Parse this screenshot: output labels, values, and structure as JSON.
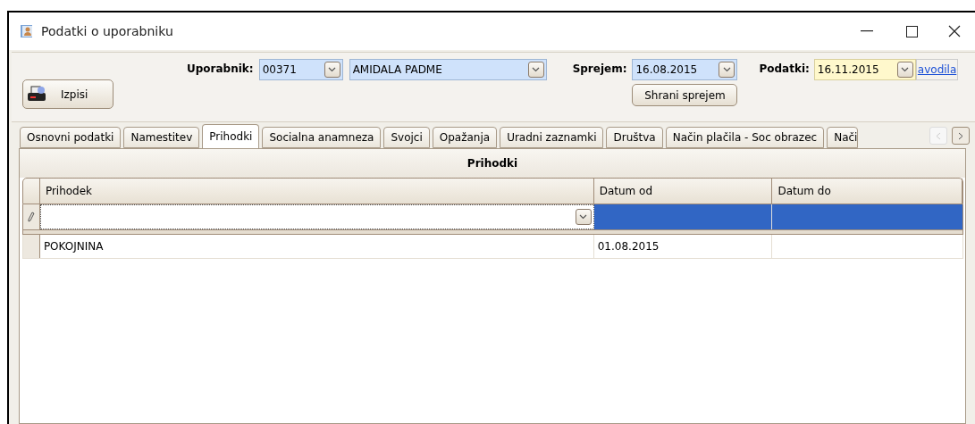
{
  "window": {
    "title": "Podatki o uporabniku"
  },
  "toolbar": {
    "print_button": "Izpisi",
    "user_label": "Uporabnik:",
    "user_code": "00371",
    "user_name": "AMIDALA PADME",
    "admission_label": "Sprejem:",
    "admission_date": "16.08.2015",
    "save_admission_button": "Shrani sprejem",
    "data_label": "Podatki:",
    "data_date": "16.11.2015",
    "instructions_link": "avodila"
  },
  "tabs": [
    {
      "label": "Osnovni podatki",
      "selected": false
    },
    {
      "label": "Namestitev",
      "selected": false
    },
    {
      "label": "Prihodki",
      "selected": true
    },
    {
      "label": "Socialna anamneza",
      "selected": false
    },
    {
      "label": "Svojci",
      "selected": false
    },
    {
      "label": "Opažanja",
      "selected": false
    },
    {
      "label": "Uradni zaznamki",
      "selected": false
    },
    {
      "label": "Društva",
      "selected": false
    },
    {
      "label": "Način plačila - Soc obrazec",
      "selected": false
    },
    {
      "label": "Nači",
      "selected": false
    }
  ],
  "tab_scroll": {
    "left_disabled": true,
    "right_disabled": false
  },
  "grid": {
    "title": "Prihodki",
    "columns": [
      "Prihodek",
      "Datum od",
      "Datum do"
    ],
    "new_row": {
      "editing": true
    },
    "rows": [
      {
        "prihodek": "POKOJNINA",
        "datum_od": "01.08.2015"
      }
    ]
  }
}
